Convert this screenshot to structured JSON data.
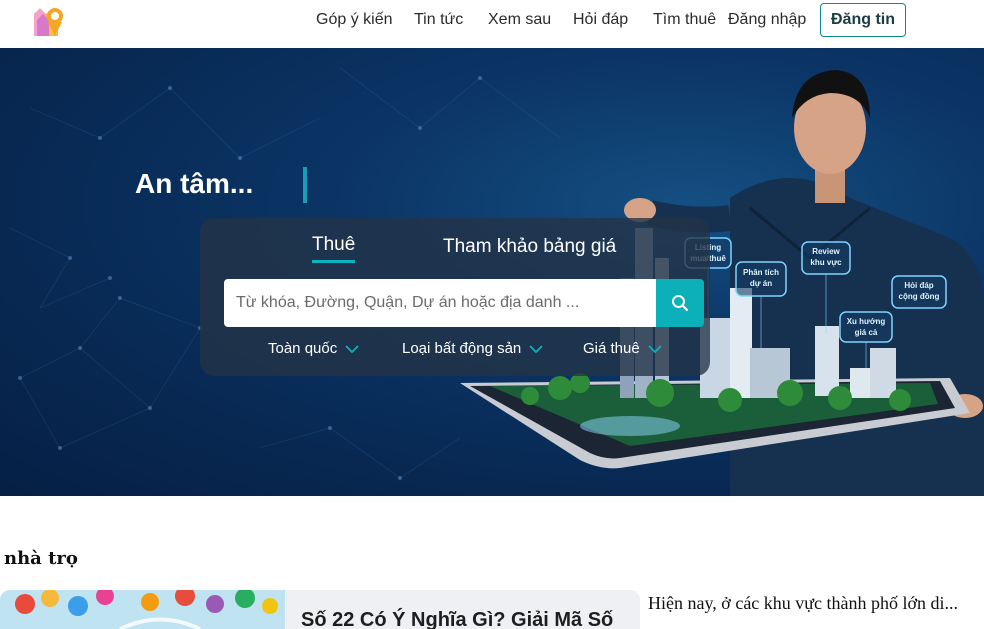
{
  "nav": {
    "items": [
      "Góp ý kiến",
      "Tin tức",
      "Xem sau",
      "Hỏi đáp",
      "Tìm thuê",
      "Đăng nhập"
    ],
    "post_label": "Đăng tin"
  },
  "hero": {
    "headline": "An tâm...",
    "tabs": [
      "Thuê",
      "Tham khảo bảng giá"
    ],
    "active_tab": "Thuê",
    "search": {
      "placeholder": "Từ khóa, Đường, Quận, Dự án hoặc địa danh ..."
    },
    "filters": [
      "Toàn quốc",
      "Loại bất động sản",
      "Giá thuê"
    ],
    "bubbles": [
      "Listing mua/thuê",
      "Phân tích dự án",
      "Review khu vực",
      "Xu hướng giá cả",
      "Hỏi đáp cộng đồng"
    ]
  },
  "section": {
    "title": "nhà trọ",
    "card_title": "Số 22 Có Ý Nghĩa Gì? Giải Mã Số",
    "side_text": "Hiện nay, ở các khu vực thành phố lớn di..."
  },
  "colors": {
    "accent": "#0bb0b8",
    "hero_bg": "#0b3566",
    "panel": "#243346"
  }
}
